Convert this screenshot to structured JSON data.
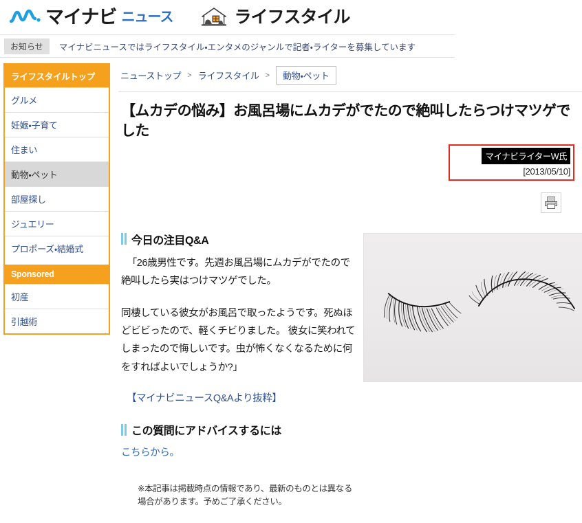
{
  "header": {
    "logo_main": "マイナビ",
    "logo_sub": "ニュース",
    "logo_mark_icon": "wave-mark-icon",
    "section_icon": "house-icon",
    "section_title": "ライフスタイル"
  },
  "notice": {
    "badge": "お知らせ",
    "text": "マイナビニュースではライフスタイル・エンタメのジャンルで記者・ライターを募集しています"
  },
  "sidebar": {
    "head": "ライフスタイルトップ",
    "items": [
      {
        "label": "グルメ",
        "active": false
      },
      {
        "label": "妊娠・子育て",
        "active": false
      },
      {
        "label": "住まい",
        "active": false
      },
      {
        "label": "動物・ペット",
        "active": true
      },
      {
        "label": "部屋探し",
        "active": false
      },
      {
        "label": "ジュエリー",
        "active": false
      },
      {
        "label": "プロポーズ・結婚式",
        "active": false
      }
    ],
    "sponsored_head": "Sponsored",
    "sponsored_items": [
      {
        "label": "初産"
      },
      {
        "label": "引越術"
      }
    ],
    "accent_color": "#f5a11e"
  },
  "breadcrumb": {
    "items": [
      "ニューストップ",
      "ライフスタイル"
    ],
    "separator": ">",
    "current": "動物・ペット"
  },
  "article": {
    "title": "【ムカデの悩み】お風呂場にムカデがでたので絶叫したらつけマツゲでした",
    "author": "マイナビライターW氏",
    "date": "[2013/05/10]",
    "byline_border_color": "#e52b20",
    "print_icon": "printer-icon"
  },
  "content": {
    "qa_heading": "今日の注目Q&A",
    "paragraph_1": "「26歳男性です。先週お風呂場にムカデがでたので絶叫したら実はつけマツゲでした。",
    "paragraph_2": "同棲している彼女がお風呂で取ったようです。死ぬほどビビったので、軽くチビりました。 彼女に笑われてしまったので悔しいです。虫が怖くなくなるために何をすればよいでしょうか?」",
    "excerpt_note": "【マイナビニュースQ&Aより抜粋】",
    "advice_heading": "この質問にアドバイスするには",
    "advice_link": "こちらから。",
    "disclaimer": "※本記事は掲載時点の情報であり、最新のものとは異なる場合があります。予めご了承ください。",
    "heading_bar_color": "#7ec8e8"
  },
  "figure": {
    "alt": "false-eyelashes-pair-photo",
    "background_color": "#eceaea"
  }
}
